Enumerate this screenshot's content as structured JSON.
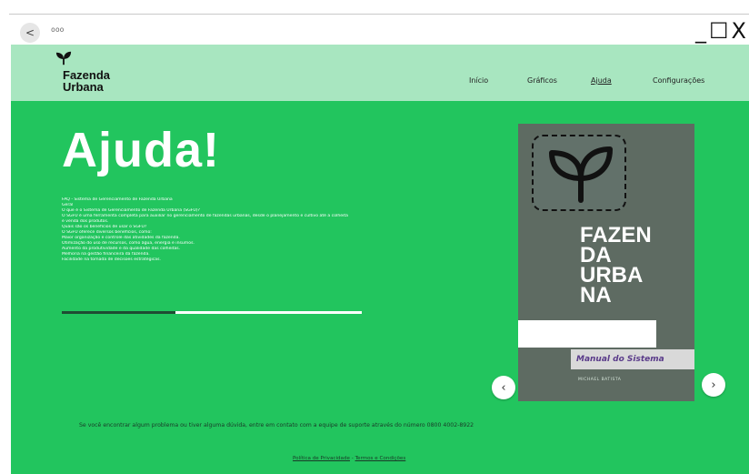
{
  "browser": {
    "back_label": "<",
    "address": "ooo",
    "window_controls": [
      "_",
      "☐",
      "X"
    ]
  },
  "header": {
    "brand_line1": "Fazenda",
    "brand_line2": "Urbana",
    "nav": [
      {
        "label": "Início",
        "active": false
      },
      {
        "label": "Gráficos",
        "active": false
      },
      {
        "label": "Ajuda",
        "active": true
      },
      {
        "label": "Configurações",
        "active": false
      }
    ]
  },
  "main": {
    "title": "Ajuda!",
    "faq_lines": [
      "FAQ - Sistema de Gerenciamento de Fazenda Urbana",
      "Geral",
      "O que é o Sistema de Gerenciamento de Fazenda Urbana (SGFU)?",
      "O SGFU é uma ferramenta completa para auxiliar no gerenciamento de fazendas urbanas, desde o planejamento e cultivo até a colheita",
      "e venda dos produtos.",
      "Quais são os benefícios de usar o SGFU?",
      "O SGFU oferece diversos benefícios, como:",
      "Maior organização e controle das atividades da fazenda.",
      "Otimização do uso de recursos, como água, energia e insumos.",
      "Aumento da produtividade e da qualidade das colheitas.",
      "Melhoria na gestão financeira da fazenda.",
      "Facilidade na tomada de decisões estratégicas."
    ],
    "progress": 0.38,
    "carousel": {
      "title_lines": [
        "FAZEN",
        "DA",
        "URBA",
        "NA"
      ],
      "manual_label": "Manual do Sistema",
      "author": "MICHAEL BATISTA",
      "prev_label": "‹",
      "next_label": "›"
    },
    "support_text": "Se você encontrar algum problema ou tiver alguma dúvida, entre em contato com a equipe de suporte através do número 0800 4002-8922",
    "footer": {
      "privacy": "Política de Privacidade",
      "separator": " - ",
      "terms": "Termos e Condições"
    }
  },
  "colors": {
    "header_bg": "#a8e6c0",
    "main_bg": "#22c55e",
    "card_bg": "#5e6b62"
  }
}
